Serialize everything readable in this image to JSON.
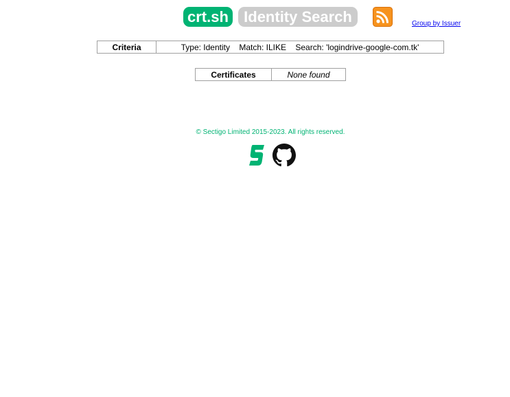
{
  "header": {
    "brand": "crt.sh",
    "title": "Identity Search",
    "rss_icon": "rss-feed-icon",
    "group_link": "Group by Issuer"
  },
  "criteria": {
    "label": "Criteria",
    "type": "Type: Identity",
    "match": "Match: ILIKE",
    "search": "Search: 'logindrive-google-com.tk'"
  },
  "certificates": {
    "label": "Certificates",
    "value": "None found"
  },
  "footer": {
    "copyright": "© Sectigo Limited 2015-2023. All rights reserved.",
    "icons": [
      "sectigo-logo-icon",
      "github-icon"
    ]
  },
  "colors": {
    "accent": "#00b373",
    "pill_gray": "#cccccc",
    "rss_orange": "#f7931e",
    "border": "#a0a0a0"
  }
}
